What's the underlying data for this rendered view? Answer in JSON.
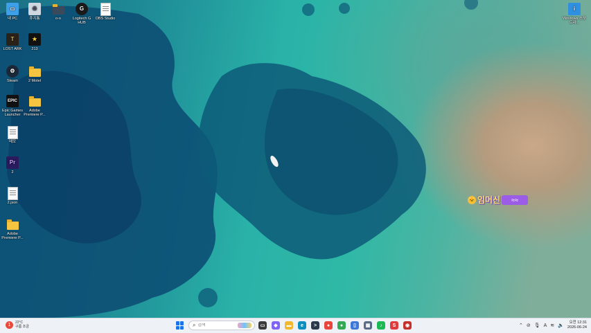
{
  "desktop": {
    "icons": [
      {
        "label": "내 PC",
        "icon": "computer-icon"
      },
      {
        "label": "휴지통",
        "icon": "recycle-bin-icon"
      },
      {
        "label": "o-o",
        "icon": "folder-icon"
      },
      {
        "label": "Logitech G HUB",
        "icon": "logitech-icon"
      },
      {
        "label": "OBS Studio",
        "icon": "document-icon"
      },
      {
        "label": "LOST ARK",
        "icon": "lost-ark-icon"
      },
      {
        "label": "213",
        "icon": "star-app-icon"
      },
      {
        "label": "Steam",
        "icon": "steam-icon"
      },
      {
        "label": "2 Motel",
        "icon": "folder-icon"
      },
      {
        "label": "Epic Games Launcher",
        "icon": "epic-games-icon"
      },
      {
        "label": "Adobe Premiere P...",
        "icon": "folder-icon"
      },
      {
        "label": "메모",
        "icon": "notepad-icon"
      },
      {
        "label": "2",
        "icon": "premiere-pro-icon"
      },
      {
        "label": "2.json",
        "icon": "json-file-icon"
      },
      {
        "label": "Adobe Premiere P...",
        "icon": "folder-icon"
      },
      {
        "label": "Windows 스포트라...",
        "icon": "spotlight-icon"
      }
    ],
    "sticker": {
      "text": "임머신",
      "emoji": "🐱",
      "badge": "≈≈"
    }
  },
  "taskbar": {
    "weather": {
      "temp": "22°C",
      "desc": "구름 조금",
      "badge": "1"
    },
    "search": {
      "placeholder": "검색"
    },
    "apps": [
      {
        "name": "file-explorer-icon",
        "glyph": "▭",
        "color": "#3a3a3a"
      },
      {
        "name": "copilot-icon",
        "glyph": "◆",
        "color": "#7f63f4"
      },
      {
        "name": "folder-icon",
        "glyph": "▬",
        "color": "#f2b830"
      },
      {
        "name": "edge-icon",
        "glyph": "e",
        "color": "#0c8fbd"
      },
      {
        "name": "terminal-icon",
        "glyph": ">",
        "color": "#2b3a4a"
      },
      {
        "name": "chrome-icon",
        "glyph": "●",
        "color": "#e8453c"
      },
      {
        "name": "chrome-alt-icon",
        "glyph": "●",
        "color": "#34a853"
      },
      {
        "name": "phone-link-icon",
        "glyph": "▯",
        "color": "#3c78d8"
      },
      {
        "name": "store-icon",
        "glyph": "▦",
        "color": "#5a6b85"
      },
      {
        "name": "spotify-icon",
        "glyph": "♪",
        "color": "#1db954"
      },
      {
        "name": "sketch-icon",
        "glyph": "S",
        "color": "#e03b3b"
      },
      {
        "name": "game-app-icon",
        "glyph": "◉",
        "color": "#c4302b"
      }
    ],
    "tray": {
      "icons": [
        "chevron-up-icon",
        "mute-icon",
        "microphone-icon",
        "ime-icon",
        "wifi-icon",
        "speaker-icon"
      ],
      "ime_label": "A",
      "time": "오전 12:31",
      "date": "2026-06-24"
    }
  }
}
